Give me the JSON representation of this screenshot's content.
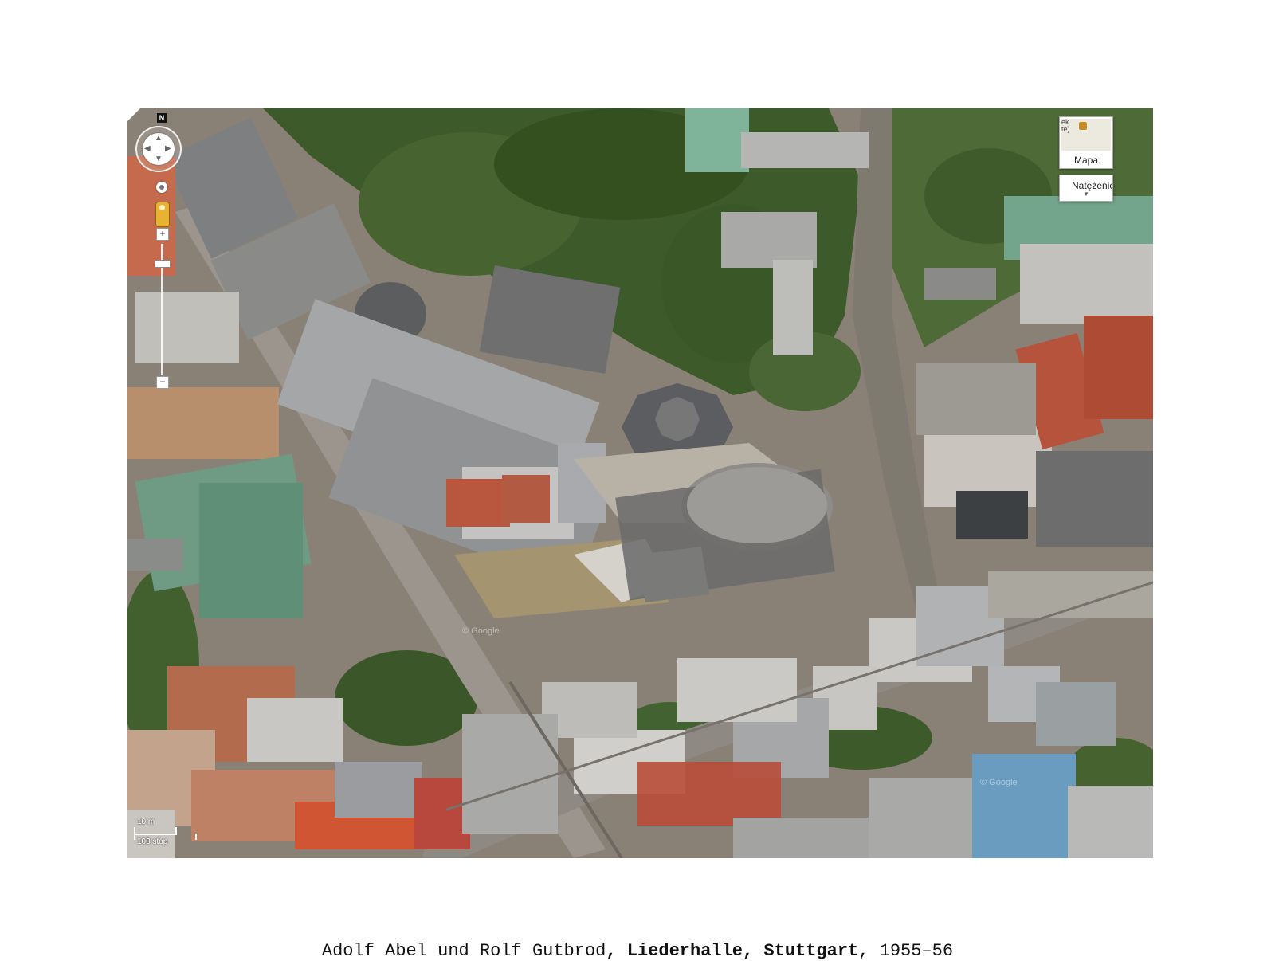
{
  "caption": {
    "architects": "Adolf Abel und Rolf Gutbrod",
    "sep1": ", ",
    "building": "Liederhalle",
    "sep2": ", ",
    "city": "Stuttgart",
    "sep3": ", ",
    "years": "1955–56"
  },
  "map": {
    "view": "aerial",
    "north_label": "N",
    "zoom_in_label": "+",
    "zoom_out_label": "−",
    "maptype": {
      "thumb_text": "ek\nte)",
      "label": "Mapa"
    },
    "traffic": {
      "label": "Natężenie",
      "caret": "▼"
    },
    "scale": {
      "metric": "10 m",
      "imperial": "100 stóp"
    },
    "watermark": "© Google",
    "icons": {
      "pan": "pan-control-icon",
      "north": "north-icon",
      "rotate": "rotate-icon",
      "pegman": "pegman-icon",
      "maptype": "map-thumbnail-icon"
    },
    "colors": {
      "trees": "#3e5a2a",
      "roof_gray": "#8f9090",
      "roof_red": "#b5513a",
      "roof_green": "#6fa28a",
      "road": "#9a9692",
      "plaza": "#c9c3b8"
    }
  }
}
